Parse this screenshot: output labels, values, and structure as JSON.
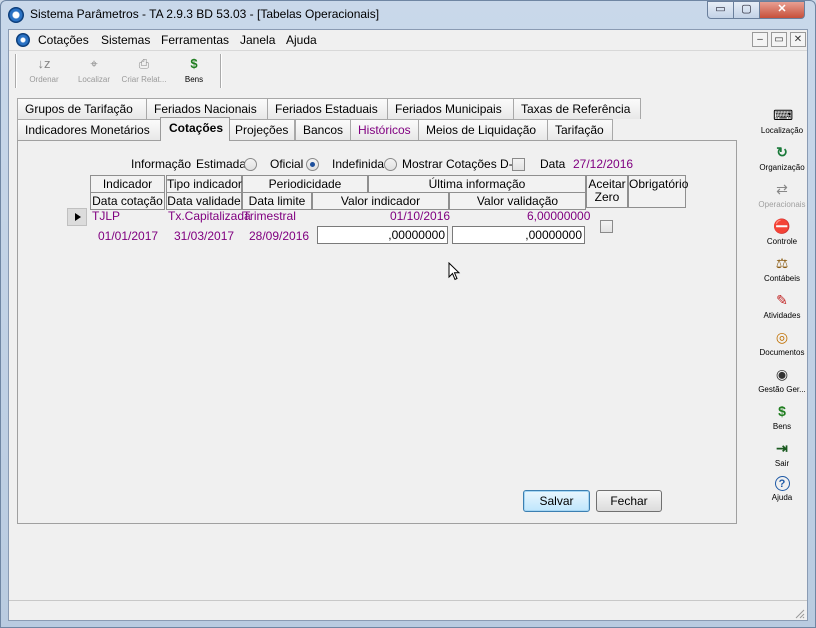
{
  "window": {
    "title": "Sistema Parâmetros -  TA 2.9.3 BD 53.03 - [Tabelas Operacionais]",
    "min_symbol": "▭",
    "max_symbol": "▢",
    "close_symbol": "✕"
  },
  "menu": {
    "items": [
      "Cotações",
      "Sistemas",
      "Ferramentas",
      "Janela",
      "Ajuda"
    ],
    "mdi_min": "–",
    "mdi_restore": "▭",
    "mdi_close": "✕"
  },
  "toolbar": {
    "buttons": [
      {
        "label": "Ordenar",
        "icon": "sort-az-icon",
        "glyph": "↓z"
      },
      {
        "label": "Localizar",
        "icon": "locate-icon",
        "glyph": "⌖"
      },
      {
        "label": "Criar Relat...",
        "icon": "printer-icon",
        "glyph": "⎙"
      },
      {
        "label": "Bens",
        "icon": "money-bag-icon",
        "glyph": "$"
      }
    ]
  },
  "sidebar": {
    "buttons": [
      {
        "label": "Localização",
        "icon": "keyboard-icon",
        "glyph": "⌨"
      },
      {
        "label": "Organização",
        "icon": "refresh-icon",
        "glyph": "↻"
      },
      {
        "label": "Operacionais",
        "icon": "handshake-icon",
        "glyph": "⇄"
      },
      {
        "label": "Controle",
        "icon": "stop-sign-icon",
        "glyph": "⛔"
      },
      {
        "label": "Contábeis",
        "icon": "scales-icon",
        "glyph": "⚖"
      },
      {
        "label": "Atividades",
        "icon": "pencil-icon",
        "glyph": "✎"
      },
      {
        "label": "Documentos",
        "icon": "target-icon",
        "glyph": "◎"
      },
      {
        "label": "Gestão Ger...",
        "icon": "eye-icon",
        "glyph": "◉"
      },
      {
        "label": "Bens",
        "icon": "money-bag-icon",
        "glyph": "$"
      },
      {
        "label": "Sair",
        "icon": "exit-door-icon",
        "glyph": "⇥"
      },
      {
        "label": "Ajuda",
        "icon": "help-icon",
        "glyph": "?"
      }
    ]
  },
  "tabs": {
    "row1": [
      "Grupos de Tarifação",
      "Feriados Nacionais",
      "Feriados Estaduais",
      "Feriados Municipais",
      "Taxas de Referência"
    ],
    "row2": [
      "Indicadores Monetários",
      "Cotações",
      "Projeções",
      "Bancos",
      "Históricos",
      "Meios de Liquidação",
      "Tarifação"
    ]
  },
  "form": {
    "info_label": "Informação",
    "opt_estimada": "Estimada",
    "opt_oficial": "Oficial",
    "opt_indefinida": "Indefinida",
    "show_d0_label": "Mostrar Cotações D-0",
    "date_label": "Data",
    "date_value": "27/12/2016"
  },
  "grid": {
    "headers_row1": [
      "Indicador",
      "Tipo indicador",
      "Periodicidade",
      "Última informação",
      "Aceitar Zero",
      "Obrigatório"
    ],
    "headers_row2": [
      "Data cotação",
      "Data validade",
      "Data limite",
      "Valor indicador",
      "Valor validação"
    ],
    "row": {
      "indicador": "TJLP",
      "tipo": "Tx.Capitalizada",
      "periodicidade": "Trimestral",
      "ultima_data": "01/10/2016",
      "ultimo_valor": "6,00000000",
      "data_cotacao": "01/01/2017",
      "data_validade": "31/03/2017",
      "data_limite": "28/09/2016",
      "valor_indicador": ",00000000",
      "valor_validacao": ",00000000"
    }
  },
  "buttons": {
    "salvar": "Salvar",
    "fechar": "Fechar"
  }
}
